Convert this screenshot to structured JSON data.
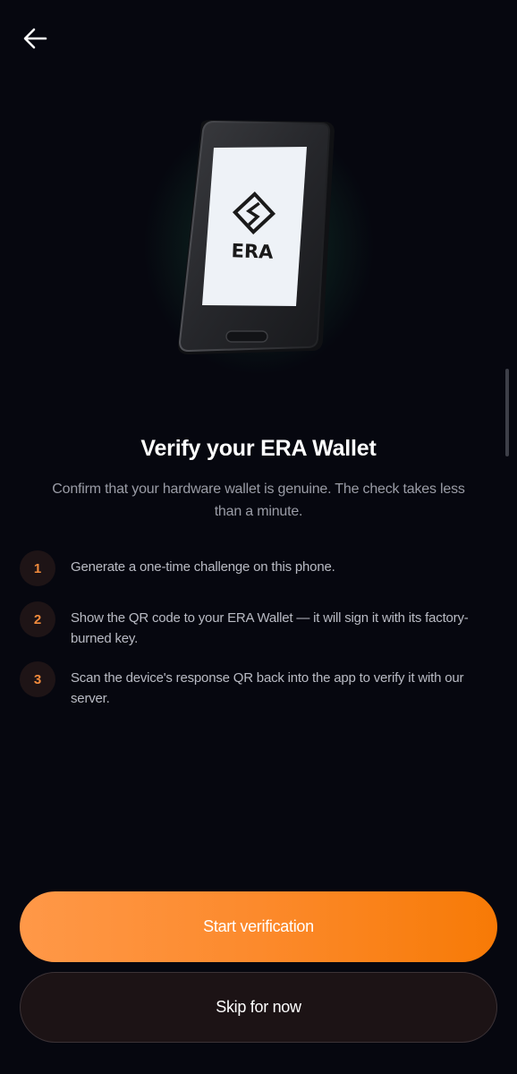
{
  "nav": {
    "back_icon": "arrow-left-icon"
  },
  "hero": {
    "device_logo_text": "ERA",
    "device_logo_icon": "era-logo-icon"
  },
  "header": {
    "title": "Verify your ERA Wallet",
    "subtitle": "Confirm that your hardware wallet is genuine. The check takes less than a minute."
  },
  "steps": [
    {
      "number": "1",
      "text": "Generate a one-time challenge on this phone."
    },
    {
      "number": "2",
      "text": "Show the QR code to your ERA Wallet — it will sign it with its factory-burned key."
    },
    {
      "number": "3",
      "text": "Scan the device's response QR back into the app to verify it with our server."
    }
  ],
  "actions": {
    "primary_label": "Start verification",
    "secondary_label": "Skip for now"
  },
  "colors": {
    "background": "#06070f",
    "accent": "#fc8a2c",
    "step_number": "#f08a3c"
  }
}
